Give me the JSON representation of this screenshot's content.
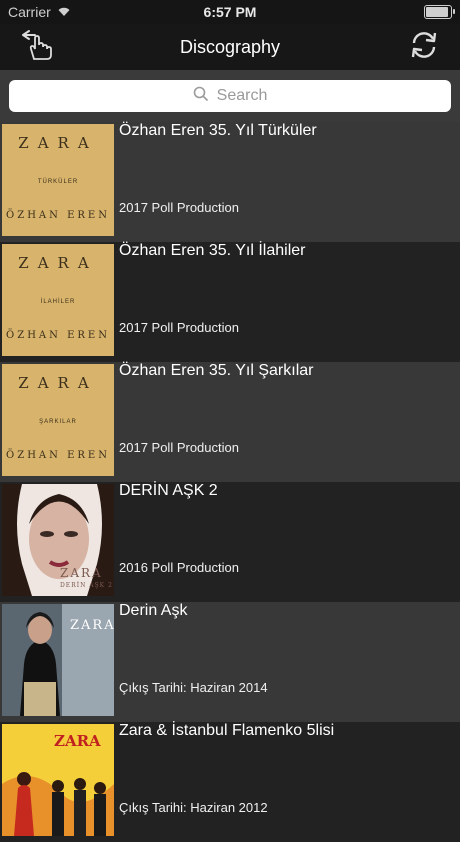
{
  "status_bar": {
    "carrier": "Carrier",
    "time": "6:57 PM"
  },
  "nav": {
    "title": "Discography",
    "back_icon": "pointing-hand-back-icon",
    "refresh_icon": "refresh-icon"
  },
  "search": {
    "placeholder": "Search"
  },
  "albums": [
    {
      "title": "Özhan Eren 35. Yıl Türküler",
      "subtitle": "2017 Poll Production",
      "cover_zara": "ZARA",
      "cover_sub": "TÜRKÜLER",
      "cover_artist": "ÖZHAN EREN"
    },
    {
      "title": "Özhan Eren 35. Yıl İlahiler",
      "subtitle": "2017 Poll Production",
      "cover_zara": "ZARA",
      "cover_sub": "İLAHİLER",
      "cover_artist": "ÖZHAN EREN"
    },
    {
      "title": "Özhan Eren 35. Yıl Şarkılar",
      "subtitle": "2017 Poll Production",
      "cover_zara": "ZARA",
      "cover_sub": "ŞARKILAR",
      "cover_artist": "ÖZHAN EREN"
    },
    {
      "title": "DERİN AŞK 2",
      "subtitle": "2016 Poll Production",
      "cover_zara": "ZARA",
      "cover_sub": "DERİN AŞK 2"
    },
    {
      "title": "Derin Aşk",
      "subtitle": "Çıkış Tarihi: Haziran 2014",
      "cover_zara": "ZARA"
    },
    {
      "title": "Zara & İstanbul Flamenko 5lisi",
      "subtitle": "Çıkış Tarihi: Haziran 2012",
      "cover_zara": "ZARA"
    }
  ],
  "colors": {
    "row_odd": "#383838",
    "row_even": "#222222",
    "gold_cover": "#d8b36c"
  }
}
